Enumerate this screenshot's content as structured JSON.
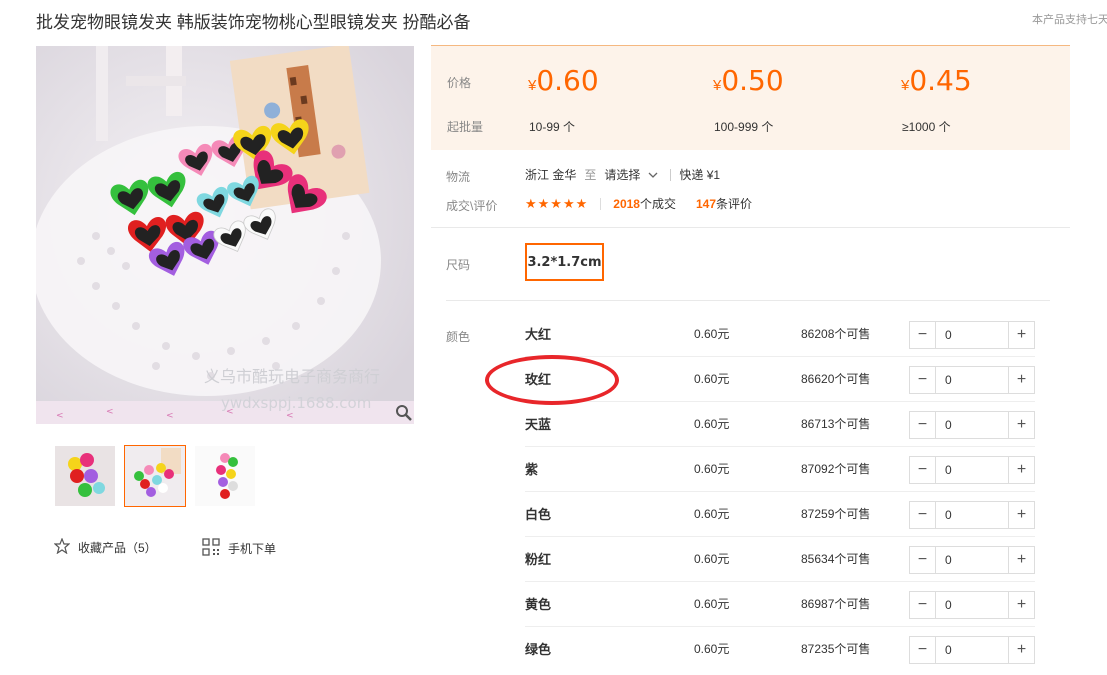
{
  "title": "批发宠物眼镜发夹 韩版装饰宠物桃心型眼镜发夹 扮酷必备",
  "support_text": "本产品支持七天",
  "gallery": {
    "watermark_line1": "义乌市酷玩电子商务商行",
    "watermark_line2": "ywdxsppj.1688.com",
    "selected_thumb": 2,
    "thumb_count": 3
  },
  "actions": {
    "favorite_label": "收藏产品（5）",
    "mobile_label": "手机下单"
  },
  "pricing": {
    "price_label": "价格",
    "moq_label": "起批量",
    "currency": "¥",
    "tiers": [
      {
        "price": "0.60",
        "range": "10-99 个"
      },
      {
        "price": "0.50",
        "range": "100-999 个"
      },
      {
        "price": "0.45",
        "range": "≥1000 个"
      }
    ]
  },
  "logistics": {
    "label": "物流",
    "origin": "浙江 金华",
    "to": "至",
    "destination": "请选择",
    "express": "快递 ¥1"
  },
  "deals": {
    "label": "成交\\评价",
    "stars": "★★★★★",
    "deal_count": "2018",
    "deal_suffix": "个成交",
    "review_count": "147",
    "review_suffix": "条评价"
  },
  "size": {
    "label": "尺码",
    "value": "3.2*1.7cm"
  },
  "colors": {
    "label": "颜色",
    "items": [
      {
        "name": "大红",
        "price": "0.60元",
        "stock": "86208个可售",
        "qty": "0"
      },
      {
        "name": "玫红",
        "price": "0.60元",
        "stock": "86620个可售",
        "qty": "0"
      },
      {
        "name": "天蓝",
        "price": "0.60元",
        "stock": "86713个可售",
        "qty": "0"
      },
      {
        "name": "紫",
        "price": "0.60元",
        "stock": "87092个可售",
        "qty": "0"
      },
      {
        "name": "白色",
        "price": "0.60元",
        "stock": "87259个可售",
        "qty": "0"
      },
      {
        "name": "粉红",
        "price": "0.60元",
        "stock": "85634个可售",
        "qty": "0"
      },
      {
        "name": "黄色",
        "price": "0.60元",
        "stock": "86987个可售",
        "qty": "0"
      },
      {
        "name": "绿色",
        "price": "0.60元",
        "stock": "87235个可售",
        "qty": "0"
      }
    ],
    "minus_symbol": "−",
    "plus_symbol": "+"
  },
  "accent_color": "#ff6600",
  "annotation_color": "#e8262a"
}
